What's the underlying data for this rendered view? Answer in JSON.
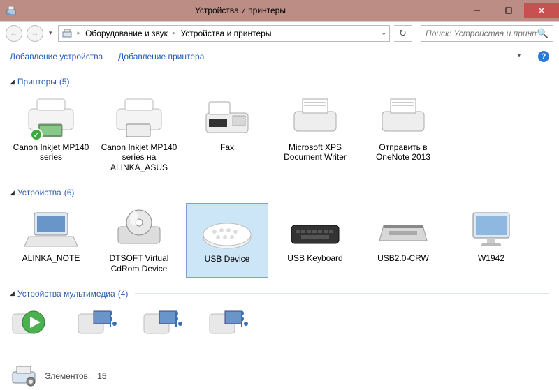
{
  "window": {
    "title": "Устройства и принтеры"
  },
  "breadcrumb": {
    "item1": "Оборудование и звук",
    "item2": "Устройства и принтеры"
  },
  "search": {
    "placeholder": "Поиск: Устройства и принте..."
  },
  "toolbar": {
    "add_device": "Добавление устройства",
    "add_printer": "Добавление принтера"
  },
  "groups": {
    "printers": {
      "label": "Принтеры",
      "count": "(5)"
    },
    "devices": {
      "label": "Устройства",
      "count": "(6)"
    },
    "multimedia": {
      "label": "Устройства мультимедиа",
      "count": "(4)"
    }
  },
  "printers": [
    {
      "name": "Canon Inkjet MP140 series",
      "default": true
    },
    {
      "name": "Canon Inkjet MP140 series на ALINKA_ASUS",
      "default": false
    },
    {
      "name": "Fax",
      "default": false
    },
    {
      "name": "Microsoft XPS Document Writer",
      "default": false
    },
    {
      "name": "Отправить в OneNote 2013",
      "default": false
    }
  ],
  "devices": [
    {
      "name": "ALINKA_NOTE"
    },
    {
      "name": "DTSOFT Virtual CdRom Device"
    },
    {
      "name": "USB Device"
    },
    {
      "name": "USB Keyboard"
    },
    {
      "name": "USB2.0-CRW"
    },
    {
      "name": "W1942"
    }
  ],
  "status": {
    "label": "Элементов:",
    "count": "15"
  }
}
